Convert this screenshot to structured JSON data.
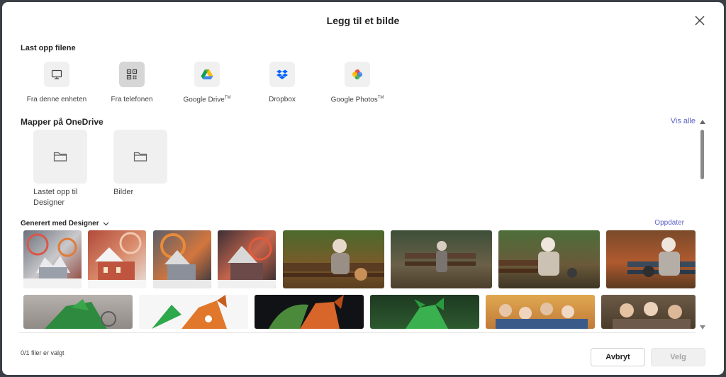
{
  "dialog": {
    "title": "Legg til et bilde"
  },
  "upload": {
    "heading": "Last opp filene",
    "items": [
      {
        "label": "Fra denne enheten",
        "tm": "",
        "icon": "monitor-icon"
      },
      {
        "label": "Fra telefonen",
        "tm": "",
        "icon": "qr-code-icon"
      },
      {
        "label": "Google Drive",
        "tm": "TM",
        "icon": "google-drive-icon"
      },
      {
        "label": "Dropbox",
        "tm": "",
        "icon": "dropbox-icon"
      },
      {
        "label": "Google Photos",
        "tm": "TM",
        "icon": "google-photos-icon"
      }
    ]
  },
  "onedrive": {
    "heading": "Mapper på OneDrive",
    "see_all": "Vis alle",
    "folders": [
      {
        "label": "Lastet opp til Designer"
      },
      {
        "label": "Bilder"
      }
    ]
  },
  "generated": {
    "heading": "Generert med Designer",
    "refresh": "Oppdater",
    "thumbnails": [
      {
        "subject": "winter-house-swirl"
      },
      {
        "subject": "winter-house-swirl"
      },
      {
        "subject": "winter-house-swirl"
      },
      {
        "subject": "winter-house-swirl"
      },
      {
        "subject": "elderly-woman-park-bench-dog"
      },
      {
        "subject": "elderly-woman-park-bench-dog"
      },
      {
        "subject": "elderly-woman-park-bench-dog"
      },
      {
        "subject": "elderly-woman-park-bench-dog"
      },
      {
        "subject": "green-fox"
      },
      {
        "subject": "green-red-fox"
      },
      {
        "subject": "red-fox-dark"
      },
      {
        "subject": "green-fox"
      },
      {
        "subject": "elderly-group"
      },
      {
        "subject": "elderly-group"
      }
    ]
  },
  "footer": {
    "status": "0/1 filer er valgt",
    "cancel": "Avbryt",
    "select": "Velg"
  },
  "colors": {
    "accent": "#5b5fc7",
    "tile_bg": "#f0f0f0"
  }
}
